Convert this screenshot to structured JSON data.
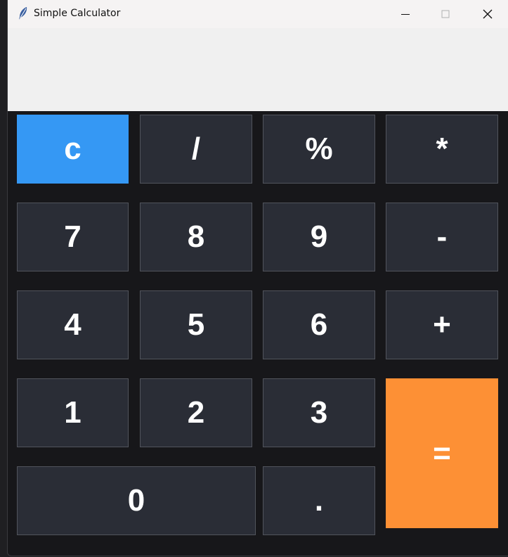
{
  "window": {
    "title": "Simple Calculator",
    "icon": "feather-icon",
    "controls": {
      "minimize": "minimize-icon",
      "maximize": "maximize-icon",
      "close": "close-icon"
    }
  },
  "display": {
    "value": ""
  },
  "keys": {
    "clear": "c",
    "divide": "/",
    "percent": "%",
    "multiply": "*",
    "seven": "7",
    "eight": "8",
    "nine": "9",
    "minus": "-",
    "four": "4",
    "five": "5",
    "six": "6",
    "plus": "+",
    "one": "1",
    "two": "2",
    "three": "3",
    "equals": "=",
    "zero": "0",
    "decimal": "."
  },
  "colors": {
    "key_bg": "#2a2d36",
    "clear_bg": "#3598f4",
    "equals_bg": "#fd9035",
    "display_bg": "#f0f0f0",
    "window_bg": "#17171a"
  }
}
